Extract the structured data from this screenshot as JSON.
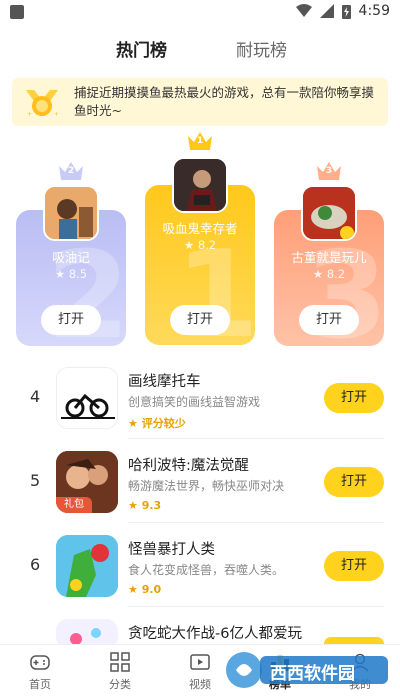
{
  "status_bar": {
    "time": "4:59"
  },
  "tabs": [
    {
      "label": "热门榜"
    },
    {
      "label": "耐玩榜"
    }
  ],
  "banner": {
    "text": "捕捉近期摸摸鱼最热最火的游戏，总有一款陪你畅享摸鱼时光~"
  },
  "podium": [
    {
      "rank": "2",
      "name": "吸油记",
      "rating": "8.5",
      "button": "打开"
    },
    {
      "rank": "1",
      "name": "吸血鬼幸存者",
      "rating": "8.2",
      "button": "打开"
    },
    {
      "rank": "3",
      "name": "古董就是玩儿",
      "rating": "8.2",
      "button": "打开"
    }
  ],
  "list": [
    {
      "rank": "4",
      "title": "画线摩托车",
      "desc": "创意搞笑的画线益智游戏",
      "rating": "评分较少",
      "button": "打开"
    },
    {
      "rank": "5",
      "title": "哈利波特:魔法觉醒",
      "desc": "畅游魔法世界，畅快巫师对决",
      "rating": "9.3",
      "button": "打开",
      "badge": "礼包"
    },
    {
      "rank": "6",
      "title": "怪兽暴打人类",
      "desc": "食人花变成怪兽，吞噬人类。",
      "rating": "9.0",
      "button": "打开"
    },
    {
      "rank": "",
      "title": "贪吃蛇大作战-6亿人都爱玩",
      "desc": "",
      "rating": "",
      "button": "打开"
    }
  ],
  "bottom_nav": [
    {
      "label": "首页",
      "icon": "gamepad-icon"
    },
    {
      "label": "分类",
      "icon": "grid-icon"
    },
    {
      "label": "视频",
      "icon": "video-icon"
    },
    {
      "label": "榜单",
      "icon": "ranking-icon"
    },
    {
      "label": "我的",
      "icon": "user-icon"
    }
  ],
  "watermark": {
    "text": "西西软件园"
  },
  "colors": {
    "accent": "#ffd21e",
    "card_rank1": "#ffc81a",
    "card_rank2": "#b9bdf3",
    "card_rank3": "#ff9f78",
    "rating_star": "#e6a100"
  }
}
